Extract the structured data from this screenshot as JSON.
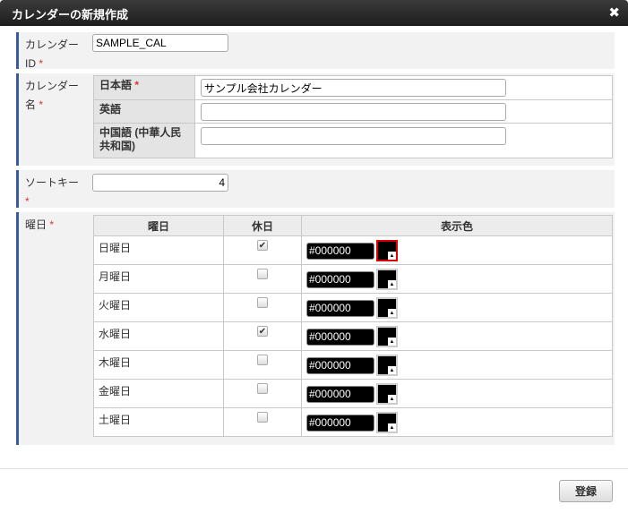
{
  "dialog": {
    "title": "カレンダーの新規作成",
    "close_icon": "close-icon"
  },
  "calendar_id": {
    "label": "カレンダーID",
    "required": "*",
    "value": "SAMPLE_CAL"
  },
  "calendar_name": {
    "label": "カレンダー名",
    "required": "*",
    "languages": [
      {
        "label": "日本語",
        "required": "*",
        "value": "サンプル会社カレンダー"
      },
      {
        "label": "英語",
        "value": ""
      },
      {
        "label": "中国語 (中華人民共和国)",
        "value": ""
      }
    ]
  },
  "sort_key": {
    "label": "ソートキー",
    "required": "*",
    "value": "4"
  },
  "weekdays": {
    "label": "曜日",
    "required": "*",
    "headers": [
      "曜日",
      "休日",
      "表示色"
    ],
    "rows": [
      {
        "day": "日曜日",
        "holiday": true,
        "color": "#000000"
      },
      {
        "day": "月曜日",
        "holiday": false,
        "color": "#000000"
      },
      {
        "day": "火曜日",
        "holiday": false,
        "color": "#000000"
      },
      {
        "day": "水曜日",
        "holiday": true,
        "color": "#000000"
      },
      {
        "day": "木曜日",
        "holiday": false,
        "color": "#000000"
      },
      {
        "day": "金曜日",
        "holiday": false,
        "color": "#000000"
      },
      {
        "day": "土曜日",
        "holiday": false,
        "color": "#000000"
      }
    ]
  },
  "footer": {
    "register_label": "登録"
  }
}
